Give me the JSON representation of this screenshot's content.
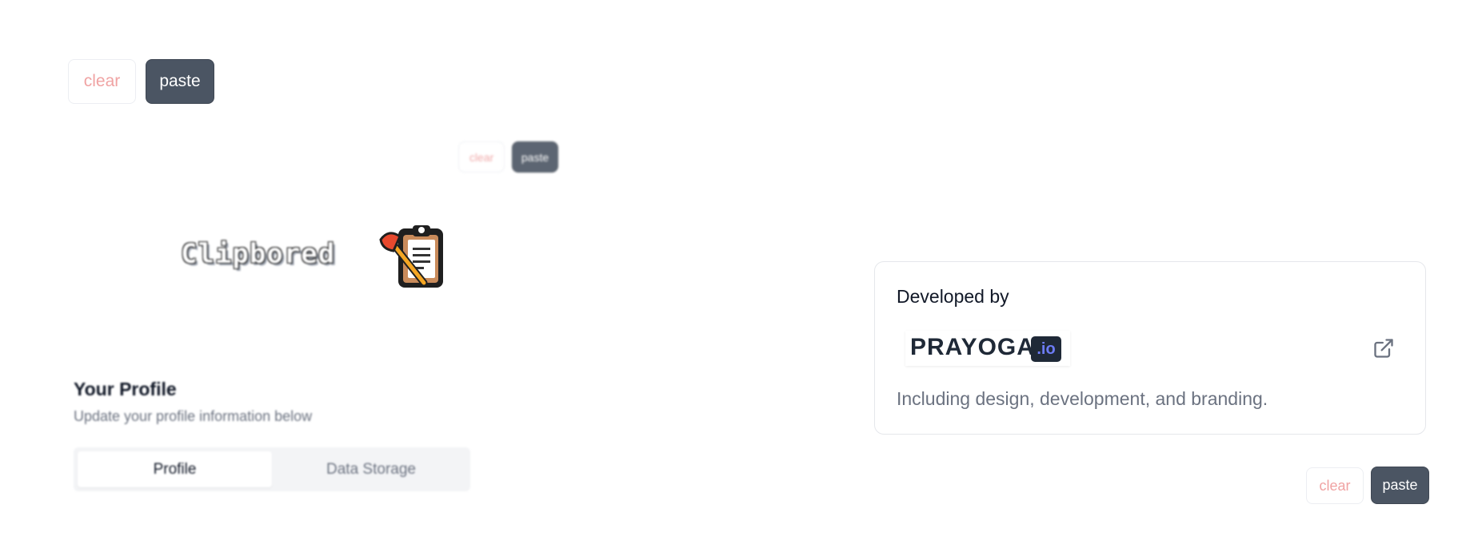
{
  "toolbars": [
    {
      "clear_label": "clear",
      "paste_label": "paste"
    },
    {
      "clear_label": "clear",
      "paste_label": "paste"
    },
    {
      "clear_label": "clear",
      "paste_label": "paste"
    }
  ],
  "logo": {
    "text": "Clipbored",
    "icon": "clipboard-axe-icon"
  },
  "profile": {
    "title": "Your Profile",
    "subtitle": "Update your profile information below",
    "tabs": [
      {
        "label": "Profile",
        "active": true
      },
      {
        "label": "Data Storage",
        "active": false
      }
    ]
  },
  "developer_card": {
    "heading": "Developed by",
    "brand": "PRAYOGA",
    "brand_suffix": ".io",
    "description": "Including design, development, and branding.",
    "link_icon": "external-link-icon"
  },
  "colors": {
    "clear_text": "#f0a3a3",
    "paste_bg": "#4b5563",
    "io_accent": "#6d7cf7"
  }
}
